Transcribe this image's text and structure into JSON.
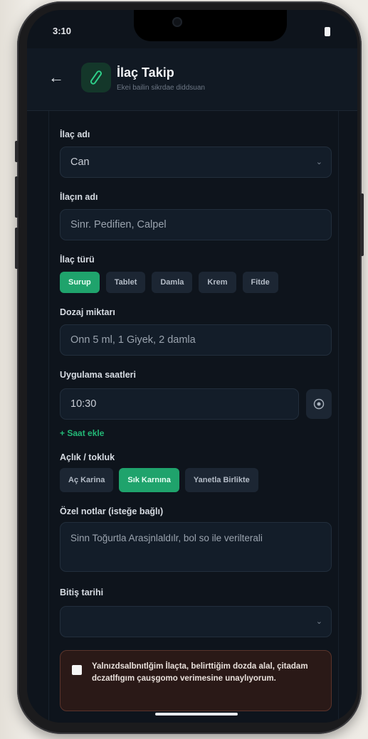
{
  "status": {
    "time": "3:10"
  },
  "header": {
    "title": "İlaç Takip",
    "subtitle": "Ekei bailin sikrdae diddsuan"
  },
  "form": {
    "drug_name_label": "İlaç adı",
    "drug_name_value": "Can",
    "person_label": "İlaçın adı",
    "person_placeholder": "Sinr. Pedifien, Calpel",
    "type_label": "İlaç türü",
    "types": [
      "Surup",
      "Tablet",
      "Damla",
      "Krem",
      "Fitde"
    ],
    "dose_label": "Dozaj miktarı",
    "dose_placeholder": "Onn 5 ml, 1 Giyek, 2 damla",
    "times_label": "Uygulama saatleri",
    "time_value": "10:30",
    "add_time": "+ Saat ekle",
    "hunger_label": "Açlık / tokluk",
    "hunger_options": [
      "Aç Karina",
      "Sık Karnına",
      "Yanetla Birlikte"
    ],
    "notes_label": "Özel notlar (isteğe bağlı)",
    "notes_placeholder": "Sinn Toğurtla Arasjnlaldılr, bol so ile verilterali",
    "start_label": "Bitiş tarihi",
    "start_value": "",
    "consent_text": "Yalnızdsalbnıtlğim İlaçta, belirttiğim dozda alal, çitadam dczatlfıgım çauşgomo verimesine unaylıyorum."
  },
  "colors": {
    "accent": "#1fa36c",
    "background": "#0e141c",
    "warning_bg": "#2a1917"
  }
}
